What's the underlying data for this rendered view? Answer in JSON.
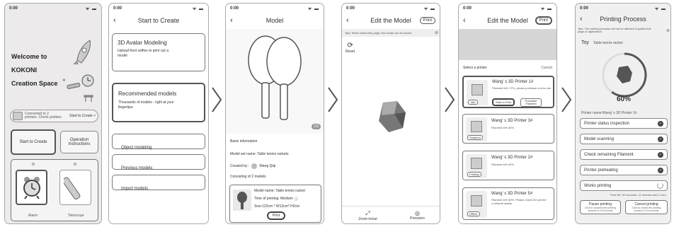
{
  "status_time": "0:00",
  "s1": {
    "welcome": [
      "Welcome to",
      "KOKONI",
      "Creation Space"
    ],
    "connected": "Connected to 2 printers. Check printers",
    "start_link": "Start to Create >",
    "start_btn": "Start to Create",
    "ops_btn": "Operation Instructions",
    "dots": [
      "o",
      "o"
    ],
    "alarm": "Alarm",
    "telescope": "Telescope"
  },
  "s2": {
    "title": "Start to Create",
    "avatar_title": "3D Avatar Modeling",
    "avatar_desc": "Upload front selfies to print out a model",
    "rec_title": "Recommended models",
    "rec_desc": "Thousands of models - right at your fingertips.",
    "menu": [
      "Object modeling",
      "Previous models",
      "Import models"
    ]
  },
  "s3": {
    "title": "Model",
    "page": "1/3",
    "basic": "Basic information",
    "set_name": "Model set name: Table tennis rackets",
    "created": "Created by :",
    "author": "Wang Qiqi",
    "consisting": "Consisting of 2 models",
    "m_name": "Model name: Table tennis racket",
    "m_time": "Time of printing: Medium",
    "m_size": "Size:123cm * W13cm* H2cm",
    "print": "Print"
  },
  "s4": {
    "title": "Edit the Model",
    "print": "Print",
    "tip": "Tips: When exited this page, the model can be saved.",
    "reset": "Reset",
    "zoom": "Zoom in/out",
    "precision": "Precision"
  },
  "s5": {
    "title": "Edit the Model",
    "print": "Print",
    "select": "Select a printer",
    "cancel": "Cancel",
    "printers": [
      {
        "name": "Wang' s 3D Printer 1#",
        "desc": "Filament left: 17%, please purchase a new one",
        "status": "Idle",
        "btn1": "Start to Print",
        "btn2": "Purchase Filament"
      },
      {
        "name": "Wang' s 3D Printer 3#",
        "desc": "Filament left: 80%",
        "status": "Suspend"
      },
      {
        "name": "Wang' s 3D Printer 2#",
        "desc": "Filament left: 60%",
        "status": "Printing"
      },
      {
        "name": "Wang' s 3D Printer 5#",
        "desc": "Filament left: 60%, Please check the printer' s network status",
        "status": "Offline"
      }
    ]
  },
  "s6": {
    "title": "Printing Process",
    "tip": "Tips: The printing process will not be affected if quitted this page or application.",
    "toy": "Toy",
    "toy_name": "Table tennis racket",
    "progress": 0.6,
    "percent": "60%",
    "printer_name": "Printer name:Wang' s 3D Printer 1#",
    "steps": [
      "Printer status inspection",
      "Model scanning",
      "Check remaining Filament",
      "Printer preheating",
      "Works printing"
    ],
    "time_left": "Time left: 32 seconds, 11 minutes and 1 hour",
    "pause": "Pause printing",
    "pause_desc": "Click to suspend the printing process in 15 seconds",
    "cancelp": "Cancel printing",
    "cancel_desc": "Click to cancel the printing process in 15 seconds"
  }
}
